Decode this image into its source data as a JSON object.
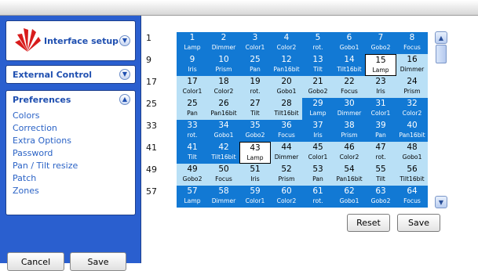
{
  "sidebar": {
    "panels": {
      "interface_setup": "Interface setup",
      "external_control": "External Control",
      "preferences": "Preferences"
    },
    "preferences_items": [
      "Colors",
      "Correction",
      "Extra Options",
      "Password",
      "Pan / Tilt resize",
      "Patch",
      "Zones"
    ],
    "cancel_label": "Cancel",
    "save_label": "Save"
  },
  "grid": {
    "row_labels": [
      "1",
      "9",
      "17",
      "25",
      "33",
      "41",
      "49",
      "57"
    ],
    "cells": [
      {
        "n": "1",
        "fn": "Lamp",
        "s": "dark"
      },
      {
        "n": "2",
        "fn": "Dimmer",
        "s": "dark"
      },
      {
        "n": "3",
        "fn": "Color1",
        "s": "dark"
      },
      {
        "n": "4",
        "fn": "Color2",
        "s": "dark"
      },
      {
        "n": "5",
        "fn": "rot.",
        "s": "dark"
      },
      {
        "n": "6",
        "fn": "Gobo1",
        "s": "dark"
      },
      {
        "n": "7",
        "fn": "Gobo2",
        "s": "dark"
      },
      {
        "n": "8",
        "fn": "Focus",
        "s": "dark"
      },
      {
        "n": "9",
        "fn": "Iris",
        "s": "dark"
      },
      {
        "n": "10",
        "fn": "Prism",
        "s": "dark"
      },
      {
        "n": "25",
        "fn": "Pan",
        "s": "dark"
      },
      {
        "n": "12",
        "fn": "Pan16bit",
        "s": "dark"
      },
      {
        "n": "13",
        "fn": "Tilt",
        "s": "dark"
      },
      {
        "n": "14",
        "fn": "Tilt16bit",
        "s": "dark"
      },
      {
        "n": "15",
        "fn": "Lamp",
        "s": "white"
      },
      {
        "n": "16",
        "fn": "Dimmer",
        "s": "light"
      },
      {
        "n": "17",
        "fn": "Color1",
        "s": "light"
      },
      {
        "n": "18",
        "fn": "Color2",
        "s": "light"
      },
      {
        "n": "19",
        "fn": "rot.",
        "s": "light"
      },
      {
        "n": "20",
        "fn": "Gobo1",
        "s": "light"
      },
      {
        "n": "21",
        "fn": "Gobo2",
        "s": "light"
      },
      {
        "n": "22",
        "fn": "Focus",
        "s": "light"
      },
      {
        "n": "23",
        "fn": "Iris",
        "s": "light"
      },
      {
        "n": "24",
        "fn": "Prism",
        "s": "light"
      },
      {
        "n": "25",
        "fn": "Pan",
        "s": "light"
      },
      {
        "n": "26",
        "fn": "Pan16bit",
        "s": "light"
      },
      {
        "n": "27",
        "fn": "Tilt",
        "s": "light"
      },
      {
        "n": "28",
        "fn": "Tilt16bit",
        "s": "light"
      },
      {
        "n": "29",
        "fn": "Lamp",
        "s": "dark"
      },
      {
        "n": "30",
        "fn": "Dimmer",
        "s": "dark"
      },
      {
        "n": "31",
        "fn": "Color1",
        "s": "dark"
      },
      {
        "n": "32",
        "fn": "Color2",
        "s": "dark"
      },
      {
        "n": "33",
        "fn": "rot.",
        "s": "dark"
      },
      {
        "n": "34",
        "fn": "Gobo1",
        "s": "dark"
      },
      {
        "n": "35",
        "fn": "Gobo2",
        "s": "dark"
      },
      {
        "n": "36",
        "fn": "Focus",
        "s": "dark"
      },
      {
        "n": "37",
        "fn": "Iris",
        "s": "dark"
      },
      {
        "n": "38",
        "fn": "Prism",
        "s": "dark"
      },
      {
        "n": "39",
        "fn": "Pan",
        "s": "dark"
      },
      {
        "n": "40",
        "fn": "Pan16bit",
        "s": "dark"
      },
      {
        "n": "41",
        "fn": "Tilt",
        "s": "dark"
      },
      {
        "n": "42",
        "fn": "Tilt16bit",
        "s": "dark"
      },
      {
        "n": "43",
        "fn": "Lamp",
        "s": "white"
      },
      {
        "n": "44",
        "fn": "Dimmer",
        "s": "light"
      },
      {
        "n": "45",
        "fn": "Color1",
        "s": "light"
      },
      {
        "n": "46",
        "fn": "Color2",
        "s": "light"
      },
      {
        "n": "47",
        "fn": "rot.",
        "s": "light"
      },
      {
        "n": "48",
        "fn": "Gobo1",
        "s": "light"
      },
      {
        "n": "49",
        "fn": "Gobo2",
        "s": "light"
      },
      {
        "n": "50",
        "fn": "Focus",
        "s": "light"
      },
      {
        "n": "51",
        "fn": "Iris",
        "s": "light"
      },
      {
        "n": "52",
        "fn": "Prism",
        "s": "light"
      },
      {
        "n": "53",
        "fn": "Pan",
        "s": "light"
      },
      {
        "n": "54",
        "fn": "Pan16bit",
        "s": "light"
      },
      {
        "n": "55",
        "fn": "Tilt",
        "s": "light"
      },
      {
        "n": "56",
        "fn": "Tilt16bit",
        "s": "light"
      },
      {
        "n": "57",
        "fn": "Lamp",
        "s": "dark"
      },
      {
        "n": "58",
        "fn": "Dimmer",
        "s": "dark"
      },
      {
        "n": "59",
        "fn": "Color1",
        "s": "dark"
      },
      {
        "n": "60",
        "fn": "Color2",
        "s": "dark"
      },
      {
        "n": "61",
        "fn": "rot.",
        "s": "dark"
      },
      {
        "n": "62",
        "fn": "Gobo1",
        "s": "dark"
      },
      {
        "n": "63",
        "fn": "Gobo2",
        "s": "dark"
      },
      {
        "n": "64",
        "fn": "Focus",
        "s": "dark"
      }
    ]
  },
  "actions": {
    "reset_label": "Reset",
    "save_label": "Save"
  },
  "colors": {
    "sidebar_blue": "#2a5fcf",
    "cell_dark": "#1279d4",
    "cell_light": "#b9e0f6",
    "logo_red": "#d81c1c"
  },
  "icons": {
    "logo": "red-fan-logo-icon",
    "collapse": "chevron-down-icon",
    "expand": "chevron-up-icon",
    "scroll_up": "arrow-up-icon",
    "scroll_down": "arrow-down-icon"
  }
}
